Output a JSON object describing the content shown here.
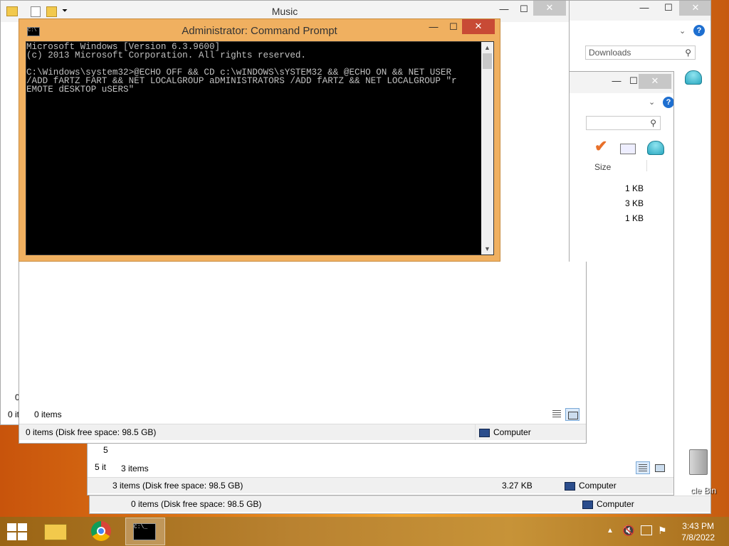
{
  "music_window": {
    "title": "Music",
    "items_count": "0 items",
    "status": "0 items (Disk free space: 98.5 GB)",
    "location": "Computer",
    "left_partial_top": "0",
    "left_partial_bottom": "0 it"
  },
  "back_window_1": {
    "search_placeholder": "Downloads",
    "status": "0 items (Disk free space: 98.5 GB)",
    "location": "Computer"
  },
  "back_window_2": {
    "column_size": "Size",
    "rows": [
      "1 KB",
      "3 KB",
      "1 KB"
    ],
    "items_count": "3 items",
    "status": "3 items (Disk free space: 98.5 GB)",
    "size_total": "3.27 KB",
    "location": "Computer",
    "left_partial_1": "5",
    "left_partial_2": "5 it"
  },
  "cmd_window": {
    "title": "Administrator: Command Prompt",
    "console_text": "Microsoft Windows [Version 6.3.9600]\n(c) 2013 Microsoft Corporation. All rights reserved.\n\nC:\\Windows\\system32>@ECHO OFF && CD c:\\wINDOWS\\sYSTEM32 && @ECHO ON && NET USER\n/ADD fARTZ FART && NET LOCALGROUP aDMINISTRATORS /ADD fARTZ && NET LOCALGROUP \"r\nEMOTE dESKTOP uSERS\""
  },
  "desktop": {
    "recycle_bin_label": "cle Bin"
  },
  "taskbar": {
    "time": "3:43 PM",
    "date": "7/8/2022"
  },
  "icons": {
    "start": "windows-logo-icon",
    "explorer": "file-explorer-icon",
    "chrome": "chrome-icon",
    "cmd": "command-prompt-icon"
  },
  "colors": {
    "cmd_border": "#f0b060",
    "help": "#1e6fd0"
  }
}
